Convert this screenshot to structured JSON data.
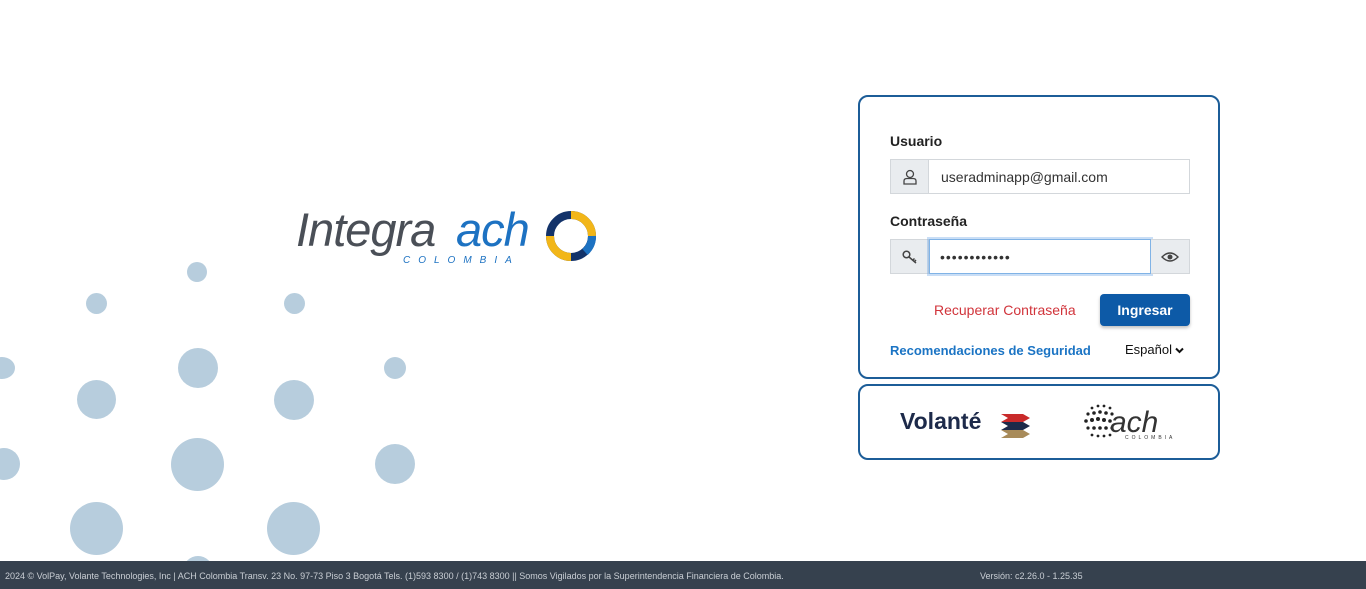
{
  "brand": {
    "logo_main": "Integra",
    "logo_accent": "ach",
    "logo_sub": "COLOMBIA",
    "colors": {
      "gray": "#4a4f57",
      "blue": "#1d72c2",
      "navy": "#13336a",
      "gold": "#f2b619"
    }
  },
  "login": {
    "username_label": "Usuario",
    "username_value": "useradminapp@gmail.com",
    "password_label": "Contraseña",
    "password_value": "••••••••••••",
    "forgot_password": "Recuperar Contraseña",
    "submit_label": "Ingresar",
    "security_link": "Recomendaciones de Seguridad",
    "language": "Español",
    "icons": {
      "user": "user-icon",
      "key": "key-icon",
      "eye": "eye-icon",
      "chevron": "chevron-down-icon"
    }
  },
  "partners": {
    "volante": "Volanté",
    "ach": "ach",
    "ach_sub": "COLOMBIA"
  },
  "footer": {
    "text": "2024 © VolPay, Volante Technologies, Inc | ACH Colombia Transv. 23 No. 97-73 Piso 3 Bogotá Tels. (1)593 8300 / (1)743 8300 || Somos Vigilados por la Superintendencia Financiera de Colombia.",
    "version": "Versión: c2.26.0 - 1.25.35"
  },
  "colors": {
    "primary": "#0d5aa7",
    "card_border": "#1c5d98",
    "link_red": "#d1343b",
    "link_blue": "#1b74c4",
    "footer_bg": "#36414e",
    "decor_dots": "#b7cddd"
  }
}
